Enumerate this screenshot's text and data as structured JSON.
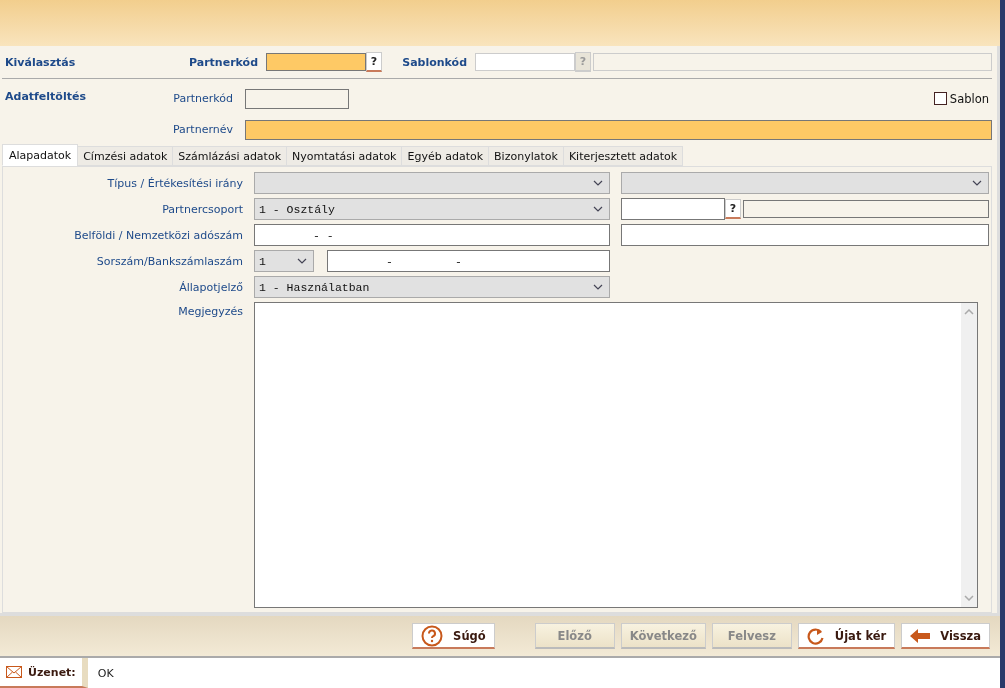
{
  "selection": {
    "title": "Kiválasztás",
    "fields": [
      {
        "label": "Partnerkód",
        "highlighted": true,
        "lookup": {
          "text": "?",
          "disabled": false
        }
      },
      {
        "label": "Sablonkód",
        "highlighted": false,
        "lookup": {
          "text": "?",
          "disabled": true
        }
      }
    ]
  },
  "upload": {
    "title": "Adatfeltöltés",
    "code_label": "Partnerkód",
    "name_label": "Partnernév",
    "template": {
      "label": "Sablon",
      "checked": false
    }
  },
  "tabs": [
    {
      "label": "Alapadatok",
      "selected": true
    },
    {
      "label": "Címzési adatok",
      "selected": false
    },
    {
      "label": "Számlázási adatok",
      "selected": false
    },
    {
      "label": "Nyomtatási adatok",
      "selected": false
    },
    {
      "label": "Egyéb adatok",
      "selected": false
    },
    {
      "label": "Bizonylatok",
      "selected": false
    },
    {
      "label": "Kiterjesztett adatok",
      "selected": false
    }
  ],
  "form": [
    {
      "label": "Típus / Értékesítési irány",
      "main": [
        {
          "kind": "select"
        }
      ],
      "side": {
        "kind": "select"
      }
    },
    {
      "label": "Partnercsoport",
      "main": [
        {
          "kind": "select",
          "value": "1 - Osztály"
        }
      ],
      "side": {
        "kind": "lookup",
        "text": "?"
      }
    },
    {
      "label": "Belföldi / Nemzetközi adószám",
      "main": [
        {
          "kind": "input",
          "value": "- -"
        }
      ],
      "side": {
        "kind": "input"
      }
    },
    {
      "label": "Sorszám/Bankszámlaszám",
      "main": [
        {
          "kind": "small_select",
          "value": "1"
        },
        {
          "kind": "input",
          "value": "-         -"
        }
      ]
    },
    {
      "label": "Állapotjelző",
      "main": [
        {
          "kind": "select",
          "value": "1 - Használatban"
        }
      ]
    },
    {
      "label": "Megjegyzés",
      "main": [
        {
          "kind": "textarea"
        }
      ]
    }
  ],
  "buttons": [
    {
      "label": "Súgó",
      "kind": "help",
      "disabled": false
    },
    {
      "label": "Előző",
      "disabled": true
    },
    {
      "label": "Következő",
      "disabled": true
    },
    {
      "label": "Felvesz",
      "disabled": true
    },
    {
      "label": "Újat kér",
      "kind": "refresh",
      "disabled": false
    },
    {
      "label": "Vissza",
      "kind": "back",
      "disabled": false
    }
  ],
  "status": {
    "label": "Üzenet:",
    "message": "OK"
  }
}
